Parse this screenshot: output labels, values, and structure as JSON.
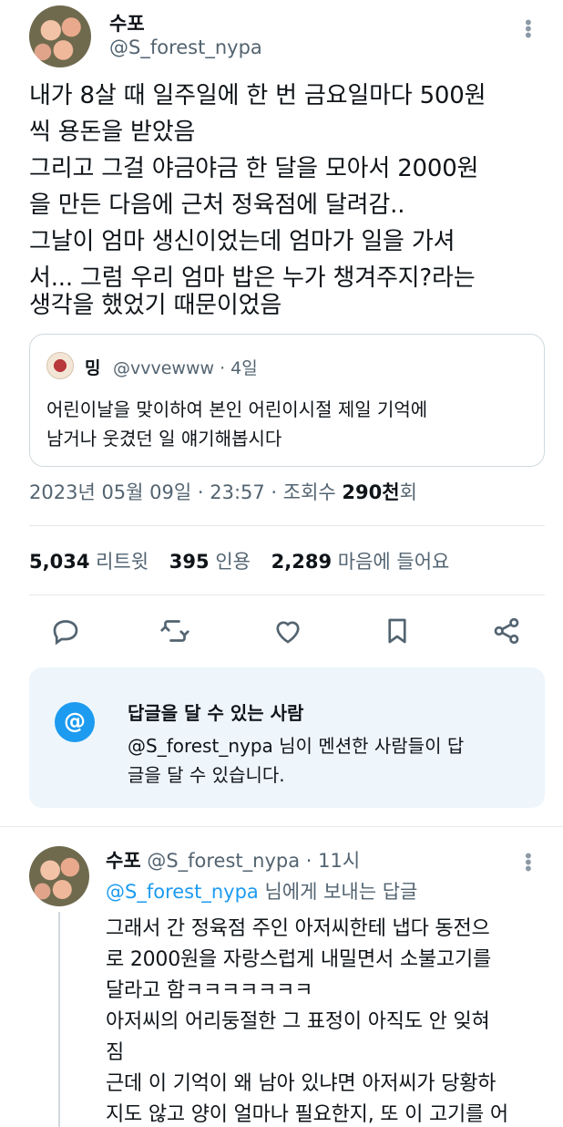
{
  "tweet": {
    "author_name": "수포",
    "author_handle": "@S_forest_nypa",
    "more_glyph": "⋮",
    "body_lines": [
      "내가 8살 때 일주일에 한 번 금요일마다 500원",
      "씩 용돈을 받았음",
      "그리고 그걸 야금야금 한 달을 모아서 2000원",
      "을 만든 다음에 근처 정육점에 달려감..",
      "그날이 엄마 생신이었는데 엄마가 일을 가셔",
      "서... 그럼 우리 엄마 밥은 누가 챙겨주지?라는",
      "생각을 했었기 때문이었음"
    ]
  },
  "quote": {
    "author_name": "밍",
    "author_handle_time": "@vvvewww · 4일",
    "text_lines": [
      "어린이날을 맞이하여 본인 어린이시절 제일 기억에",
      "남거나 웃겼던 일 얘기해봅시다"
    ]
  },
  "meta": {
    "datetime": "2023년 05월 09일 · 23:57 · 조회수 ",
    "views_value": "290천",
    "views_suffix": "회"
  },
  "stats": {
    "retweets_value": "5,034",
    "retweets_label": "리트윗",
    "quotes_value": "395",
    "quotes_label": "인용",
    "likes_value": "2,289",
    "likes_label": "마음에 들어요"
  },
  "actions": [
    "reply-icon",
    "retweet-icon",
    "like-icon",
    "bookmark-icon",
    "share-icon"
  ],
  "reply_restriction": {
    "icon_glyph": "@",
    "title": "답글을 달 수 있는 사람",
    "line1_mention": "@S_forest_nypa",
    "line1_rest": " 님이 멘션한 사람들이 답",
    "line2": "글을 달 수 있습니다."
  },
  "reply": {
    "author_name": "수포",
    "author_handle_time": " @S_forest_nypa · 11시",
    "replying_mention": "@S_forest_nypa",
    "replying_rest": " 님에게 보내는 답글",
    "more_glyph": "⋮",
    "body_lines": [
      "그래서 간 정육점 주인 아저씨한테 냅다 동전으",
      "로 2000원을 자랑스럽게 내밀면서 소불고기를",
      "달라고 함ㅋㅋㅋㅋㅋㅋㅋ",
      "아저씨의 어리둥절한 그 표정이 아직도 안 잊혀",
      "짐",
      "근데 이 기억이 왜 남아 있냐면 아저씨가 당황하",
      "지도 않고 양이 얼마나 필요한지, 또 이 고기를 어"
    ]
  },
  "colors": {
    "accent": "#1d9bf0",
    "secondary_text": "#536471",
    "reply_box_bg": "#eef6fc"
  }
}
